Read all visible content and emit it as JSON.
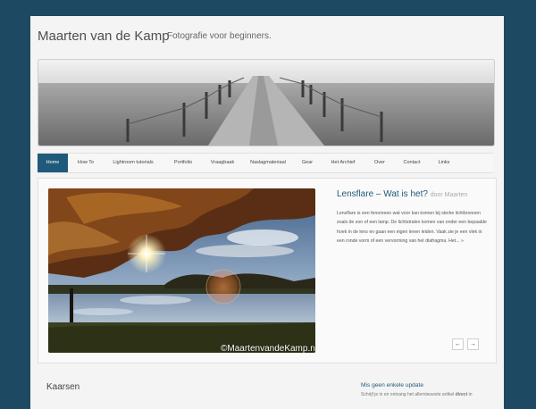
{
  "site": {
    "title": "Maarten van de Kamp",
    "description": "Fotografie voor beginners."
  },
  "nav": {
    "items": [
      {
        "label": "Home",
        "active": true
      },
      {
        "label": "How To"
      },
      {
        "label": "Lightroom tutorials"
      },
      {
        "label": "Portfolio"
      },
      {
        "label": "Vraagbaak"
      },
      {
        "label": "Naslagmateriaal"
      },
      {
        "label": "Gear"
      },
      {
        "label": "Het Archief"
      },
      {
        "label": "Over"
      },
      {
        "label": "Contact"
      },
      {
        "label": "Links"
      }
    ]
  },
  "slider": {
    "title": "Lensflare – Wat is het?",
    "author": "door Maarten",
    "excerpt": "Lensflare is een fenomeen wat voor kan komen bij sterke lichtbronnen zoals de zon of een lamp. De lichtstralen komen van onder een bepaalde hoek in de lens en gaan een eigen leven leiden. Vaak zie je een vlek in een ronde vorm of een vervorming van het diafragma. Het...",
    "more": "»",
    "watermark": "©MaartenvandeKamp.nl",
    "prev_label": "←",
    "next_label": "→"
  },
  "post": {
    "title": "Kaarsen"
  },
  "widget": {
    "title": "Mis geen enkele update",
    "text_before": "Schrijf je in en ontvang het allernieuwste artikel ",
    "text_bold": "direct",
    "text_after": " in"
  },
  "colors": {
    "background": "#1d4a62",
    "accent": "#1f5a7a",
    "page": "#f4f4f4"
  }
}
